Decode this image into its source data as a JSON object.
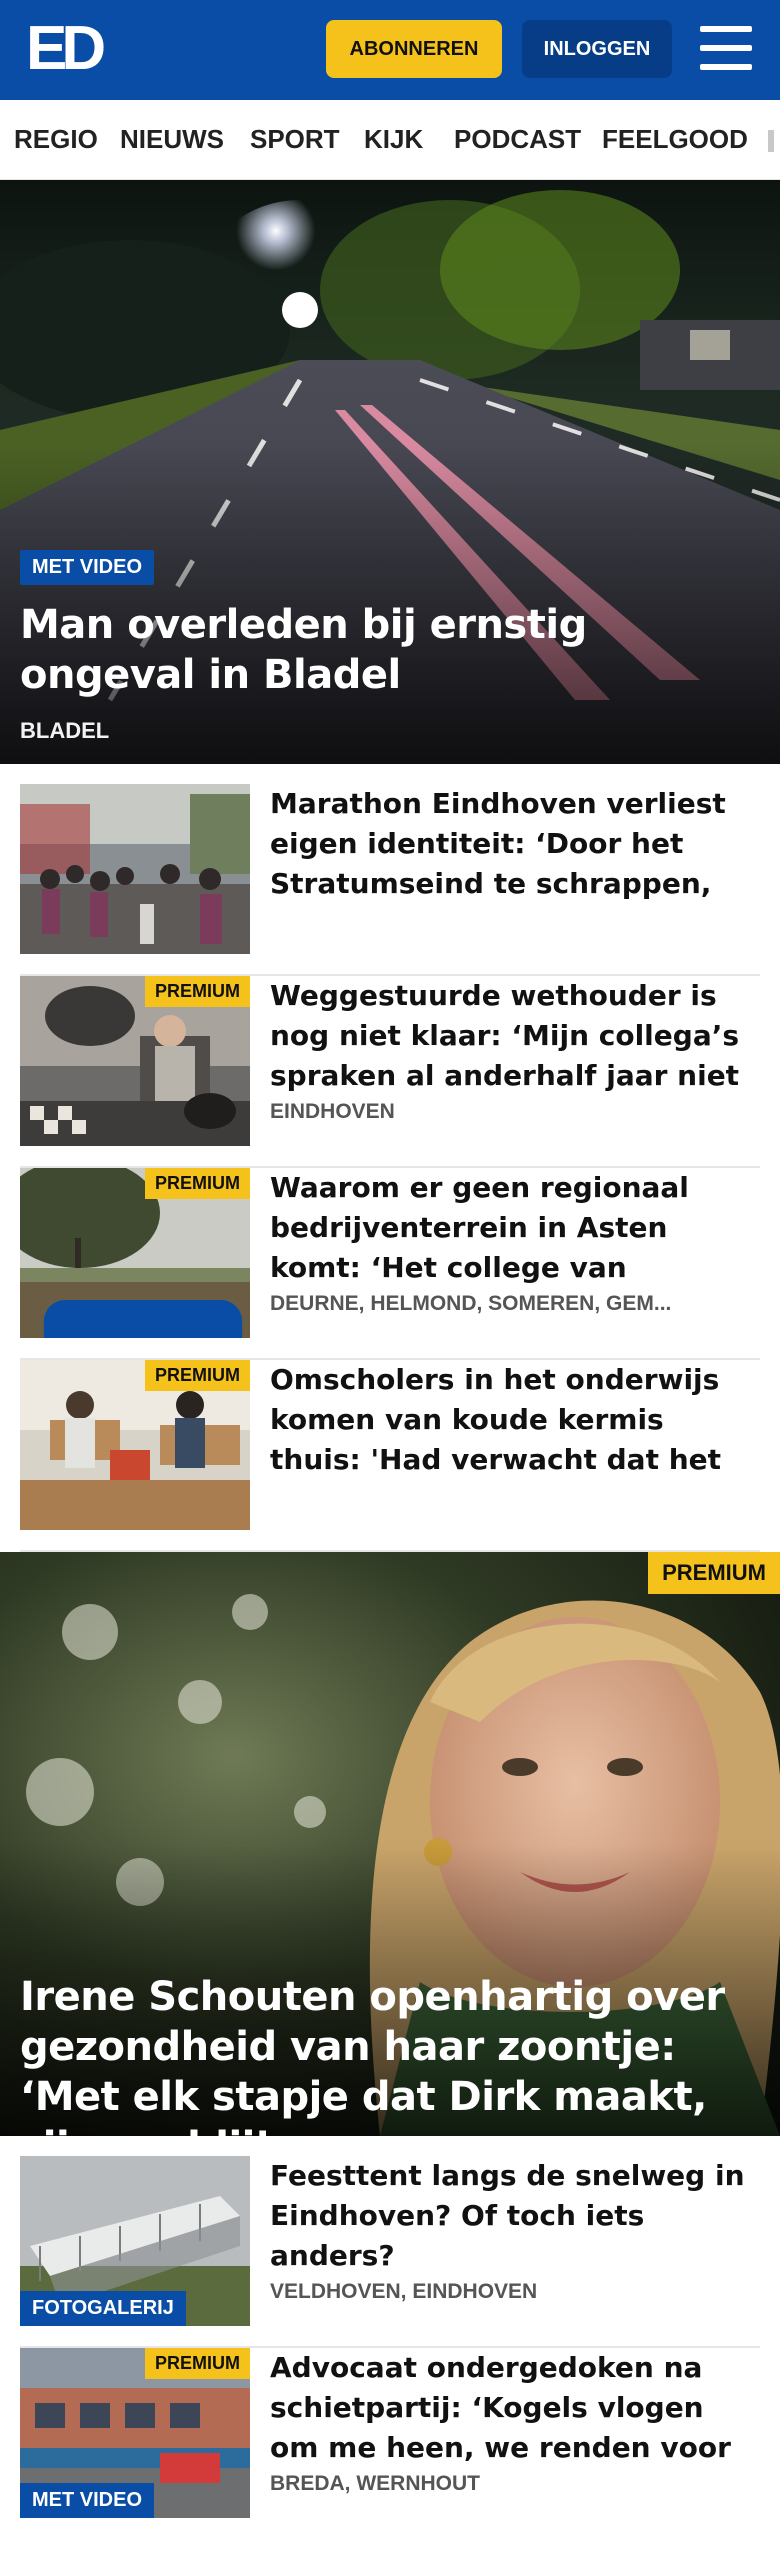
{
  "header": {
    "logo": "ED",
    "subscribe_label": "ABONNEREN",
    "login_label": "INLOGGEN",
    "menu_icon": "hamburger-menu-icon",
    "brand_color": "#0a4da6",
    "accent_color": "#f5c21b"
  },
  "nav": {
    "items": [
      "REGIO",
      "NIEUWS",
      "SPORT",
      "KIJK",
      "PODCAST",
      "FEELGOOD"
    ]
  },
  "hero": {
    "badge": "MET VIDEO",
    "title": "Man overleden bij ernstig ongeval in Bladel",
    "location": "BLADEL"
  },
  "articles": [
    {
      "title": "Marathon Eindhoven verliest eigen identiteit: ‘Door het Stratumseind te schrappen, ha...",
      "location": ""
    },
    {
      "badge": "PREMIUM",
      "title": "Weggestuurde wethouder is nog niet klaar: ‘Mijn collega’s spraken al anderhalf jaar niet met hun...",
      "location": "EINDHOVEN"
    },
    {
      "badge": "PREMIUM",
      "title": "Waarom er geen regionaal bedrijventerrein in Asten komt: ‘Het college van Someren heeft...",
      "location": "DEURNE, HELMOND, SOMEREN, GEM..."
    },
    {
      "badge": "PREMIUM",
      "title": "Omscholers in het onderwijs komen van koude kermis thuis: 'Had verwacht dat het makkelij-...",
      "location": ""
    }
  ],
  "feature": {
    "badge": "PREMIUM",
    "title": "Irene Schouten openhartig over gezondheid van haar zoontje: ‘Met elk stapje dat Dirk maakt, zijn we blij’"
  },
  "articles2": [
    {
      "badge": "FOTOGALERIJ",
      "title": "Feesttent langs de snelweg in Eindhoven? Of toch iets anders?",
      "location": "VELDHOVEN, EINDHOVEN"
    },
    {
      "badge": "PREMIUM",
      "badge2": "MET VIDEO",
      "title": "Advocaat ondergedoken na schietpartij: ‘Kogels vlogen om me heen, we renden voor ons...",
      "location": "BREDA, WERNHOUT"
    }
  ]
}
